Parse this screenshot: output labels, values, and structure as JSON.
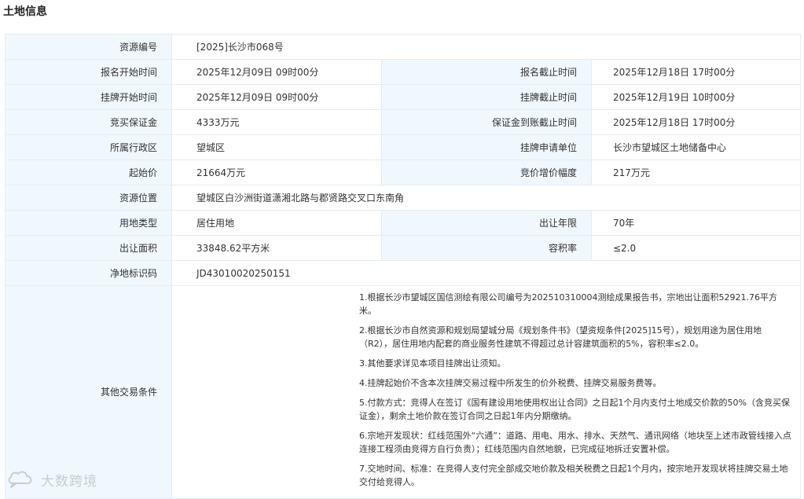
{
  "title": "土地信息",
  "fields": {
    "resource_no_label": "资源编号",
    "resource_no": "[2025]长沙市068号",
    "reg_start_label": "报名开始时间",
    "reg_start": "2025年12月09日 09时00分",
    "reg_end_label": "报名截止时间",
    "reg_end": "2025年12月18日 17时00分",
    "list_start_label": "挂牌开始时间",
    "list_start": "2025年12月09日 09时00分",
    "list_end_label": "挂牌截止时间",
    "list_end": "2025年12月19日 10时00分",
    "deposit_label": "竞买保证金",
    "deposit": "4333万元",
    "deposit_deadline_label": "保证金到账截止时间",
    "deposit_deadline": "2025年12月18日 17时00分",
    "district_label": "所属行政区",
    "district": "望城区",
    "applicant_unit_label": "挂牌申请单位",
    "applicant_unit": "长沙市望城区土地储备中心",
    "start_price_label": "起始价",
    "start_price": "21664万元",
    "increment_label": "竞价增价幅度",
    "increment": "217万元",
    "location_label": "资源位置",
    "location": "望城区白沙洲街道潇湘北路与郡贤路交叉口东南角",
    "land_use_label": "用地类型",
    "land_use": "居住用地",
    "term_years_label": "出让年限",
    "term_years": "70年",
    "area_label": "出让面积",
    "area": "33848.62平方米",
    "far_label": "容积率",
    "far": "≤2.0",
    "net_land_id_label": "净地标识码",
    "net_land_id": "JD43010020250151",
    "other_terms_label": "其他交易条件"
  },
  "other_terms": [
    "1.根据长沙市望城区国信测绘有限公司编号为202510310004测绘成果报告书，宗地出让面积52921.76平方米。",
    "2.根据长沙市自然资源和规划局望城分局《规划条件书》（望资规条件[2025]15号），规划用途为居住用地（R2），居住用地内配套的商业服务性建筑不得超过总计容建筑面积的5%，容积率≤2.0。",
    "3.其他要求详见本项目挂牌出让须知。",
    "4.挂牌起始价不含本次挂牌交易过程中所发生的价外税费、挂牌交易服务费等。",
    "5.付款方式：竞得人在签订《国有建设用地使用权出让合同》之日起1个月内支付土地成交价款的50%（含竞买保证金），剩余土地价款在签订合同之日起1年内分期缴纳。",
    "6.宗地开发现状：红线范围外“六通”：道路、用电、用水、排水、天然气、通讯网络（地块至上述市政管线接入点连接工程须由竞得方自行负责）；红线范围内自然地貌，已完成征地拆迁安置补偿。",
    "7.交地时间、标准：在竞得人支付完全部成交地价款及相关税费之日起1个月内，按宗地开发现状将挂牌交易土地交付给竞得人。"
  ],
  "watermark": {
    "text": "大数跨境",
    "icon": "cloud-chat-icon"
  }
}
